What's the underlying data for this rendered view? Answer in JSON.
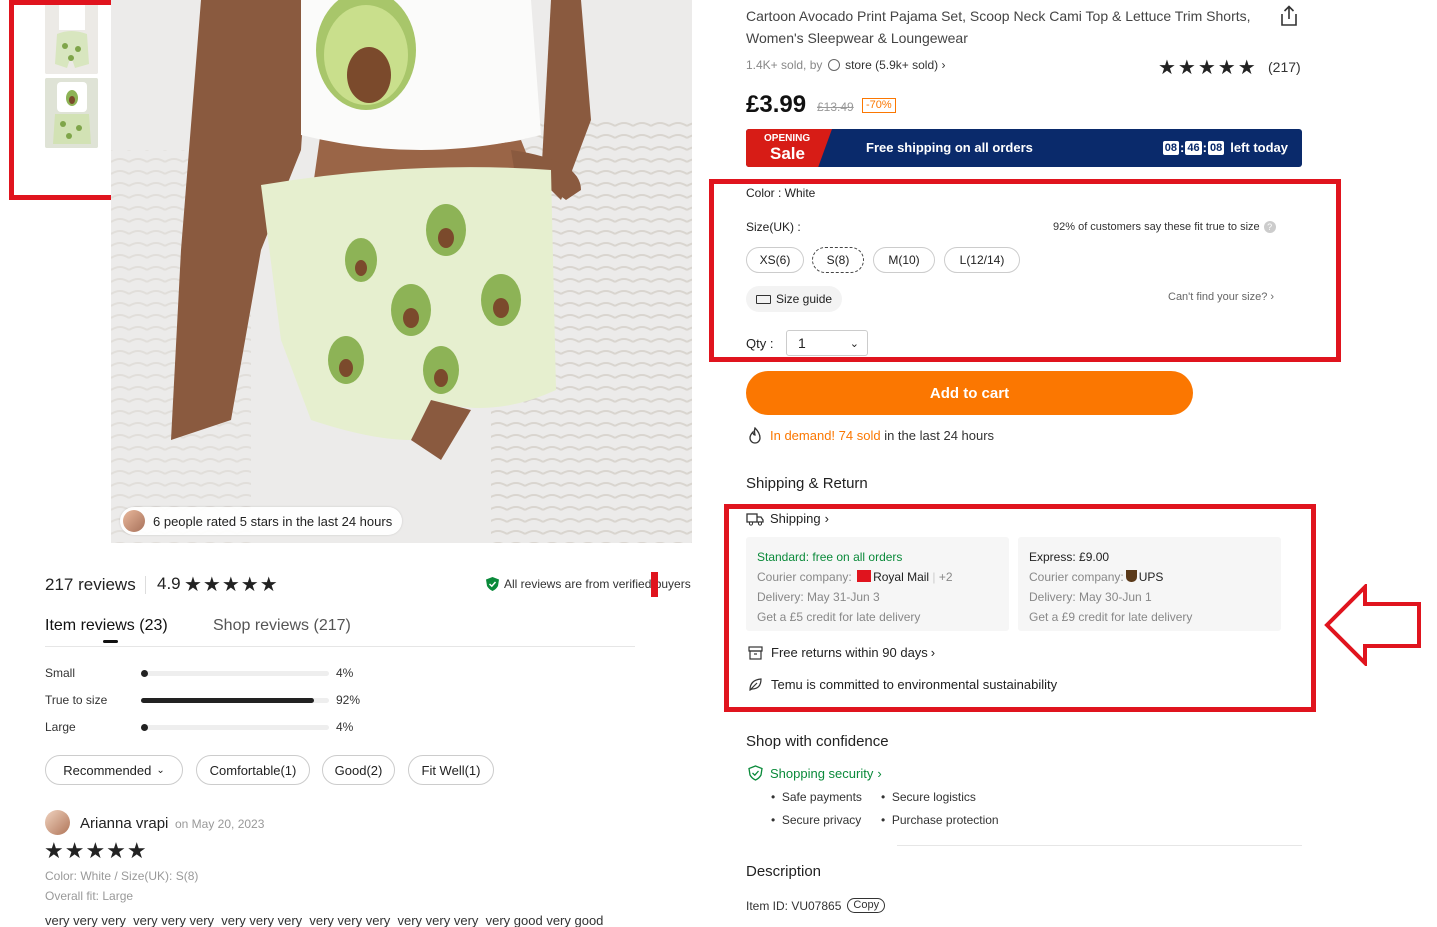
{
  "product": {
    "title": "Cartoon Avocado Print Pajama Set, Scoop Neck Cami Top & Lettuce Trim Shorts, Women's Sleepwear & Loungewear",
    "sold": "1.4K+ sold, by",
    "store": "store",
    "store_sold": "(5.9k+ sold)",
    "rating_count": "(217)",
    "price": "£3.99",
    "old_price": "£13.49",
    "discount": "-70%"
  },
  "banner": {
    "opening": "OPENING",
    "sale": "Sale",
    "free_shipping": "Free shipping on all orders",
    "hh": "08",
    "mm": "46",
    "ss": "08",
    "left_today": "left today"
  },
  "options": {
    "color_label": "Color : White",
    "size_label": "Size(UK) :",
    "fit_note": "92% of customers say these fit true to size",
    "sizes": [
      "XS(6)",
      "S(8)",
      "M(10)",
      "L(12/14)"
    ],
    "size_guide": "Size guide",
    "cant_find": "Can't find your size?",
    "qty_label": "Qty :",
    "qty_value": "1"
  },
  "cart": {
    "add_to_cart": "Add to cart",
    "demand_hl": "In demand! 74 sold",
    "demand_rest": "in the last 24 hours"
  },
  "shipping": {
    "section_title": "Shipping & Return",
    "shipping_link": "Shipping",
    "standard": {
      "head": "Standard: free on all orders",
      "courier_label": "Courier company:",
      "courier": "Royal Mail",
      "more": "+2",
      "delivery": "Delivery: May 31-Jun 3",
      "credit": "Get a £5 credit for late delivery"
    },
    "express": {
      "head": "Express: £9.00",
      "courier_label": "Courier company:",
      "courier": "UPS",
      "delivery": "Delivery: May 30-Jun 1",
      "credit": "Get a £9 credit for late delivery"
    },
    "returns": "Free returns within 90 days",
    "sustain": "Temu is committed to environmental sustainability"
  },
  "confidence": {
    "title": "Shop with confidence",
    "security": "Shopping security",
    "items": [
      "Safe payments",
      "Secure logistics",
      "Secure privacy",
      "Purchase protection"
    ]
  },
  "description": {
    "title": "Description",
    "item_id": "Item ID: VU07865",
    "copy": "Copy"
  },
  "image": {
    "rated_pill": "6 people rated 5 stars in the last 24 hours"
  },
  "reviews": {
    "count": "217 reviews",
    "score": "4.9",
    "verified": "All reviews are from verified buyers",
    "tab_item": "Item reviews (23)",
    "tab_shop": "Shop reviews (217)",
    "fit": [
      {
        "label": "Small",
        "pct": "4%",
        "value": 0.04
      },
      {
        "label": "True to size",
        "pct": "92%",
        "value": 0.92
      },
      {
        "label": "Large",
        "pct": "4%",
        "value": 0.04
      }
    ],
    "filters": [
      "Recommended",
      "Comfortable(1)",
      "Good(2)",
      "Fit Well(1)"
    ],
    "review": {
      "name": "Arianna vrapi",
      "date": "on May 20, 2023",
      "variant": "Color: White / Size(UK): S(8)",
      "overall": "Overall fit: Large",
      "text": "very very very  very very very  very very very  very very very  very very very  very good very good"
    }
  },
  "stars_text": "★★★★★",
  "colors": {
    "accent": "#fb7701",
    "highlight_box": "#e0141e",
    "banner": "#0a2a6b",
    "green": "#0a8a3a"
  }
}
